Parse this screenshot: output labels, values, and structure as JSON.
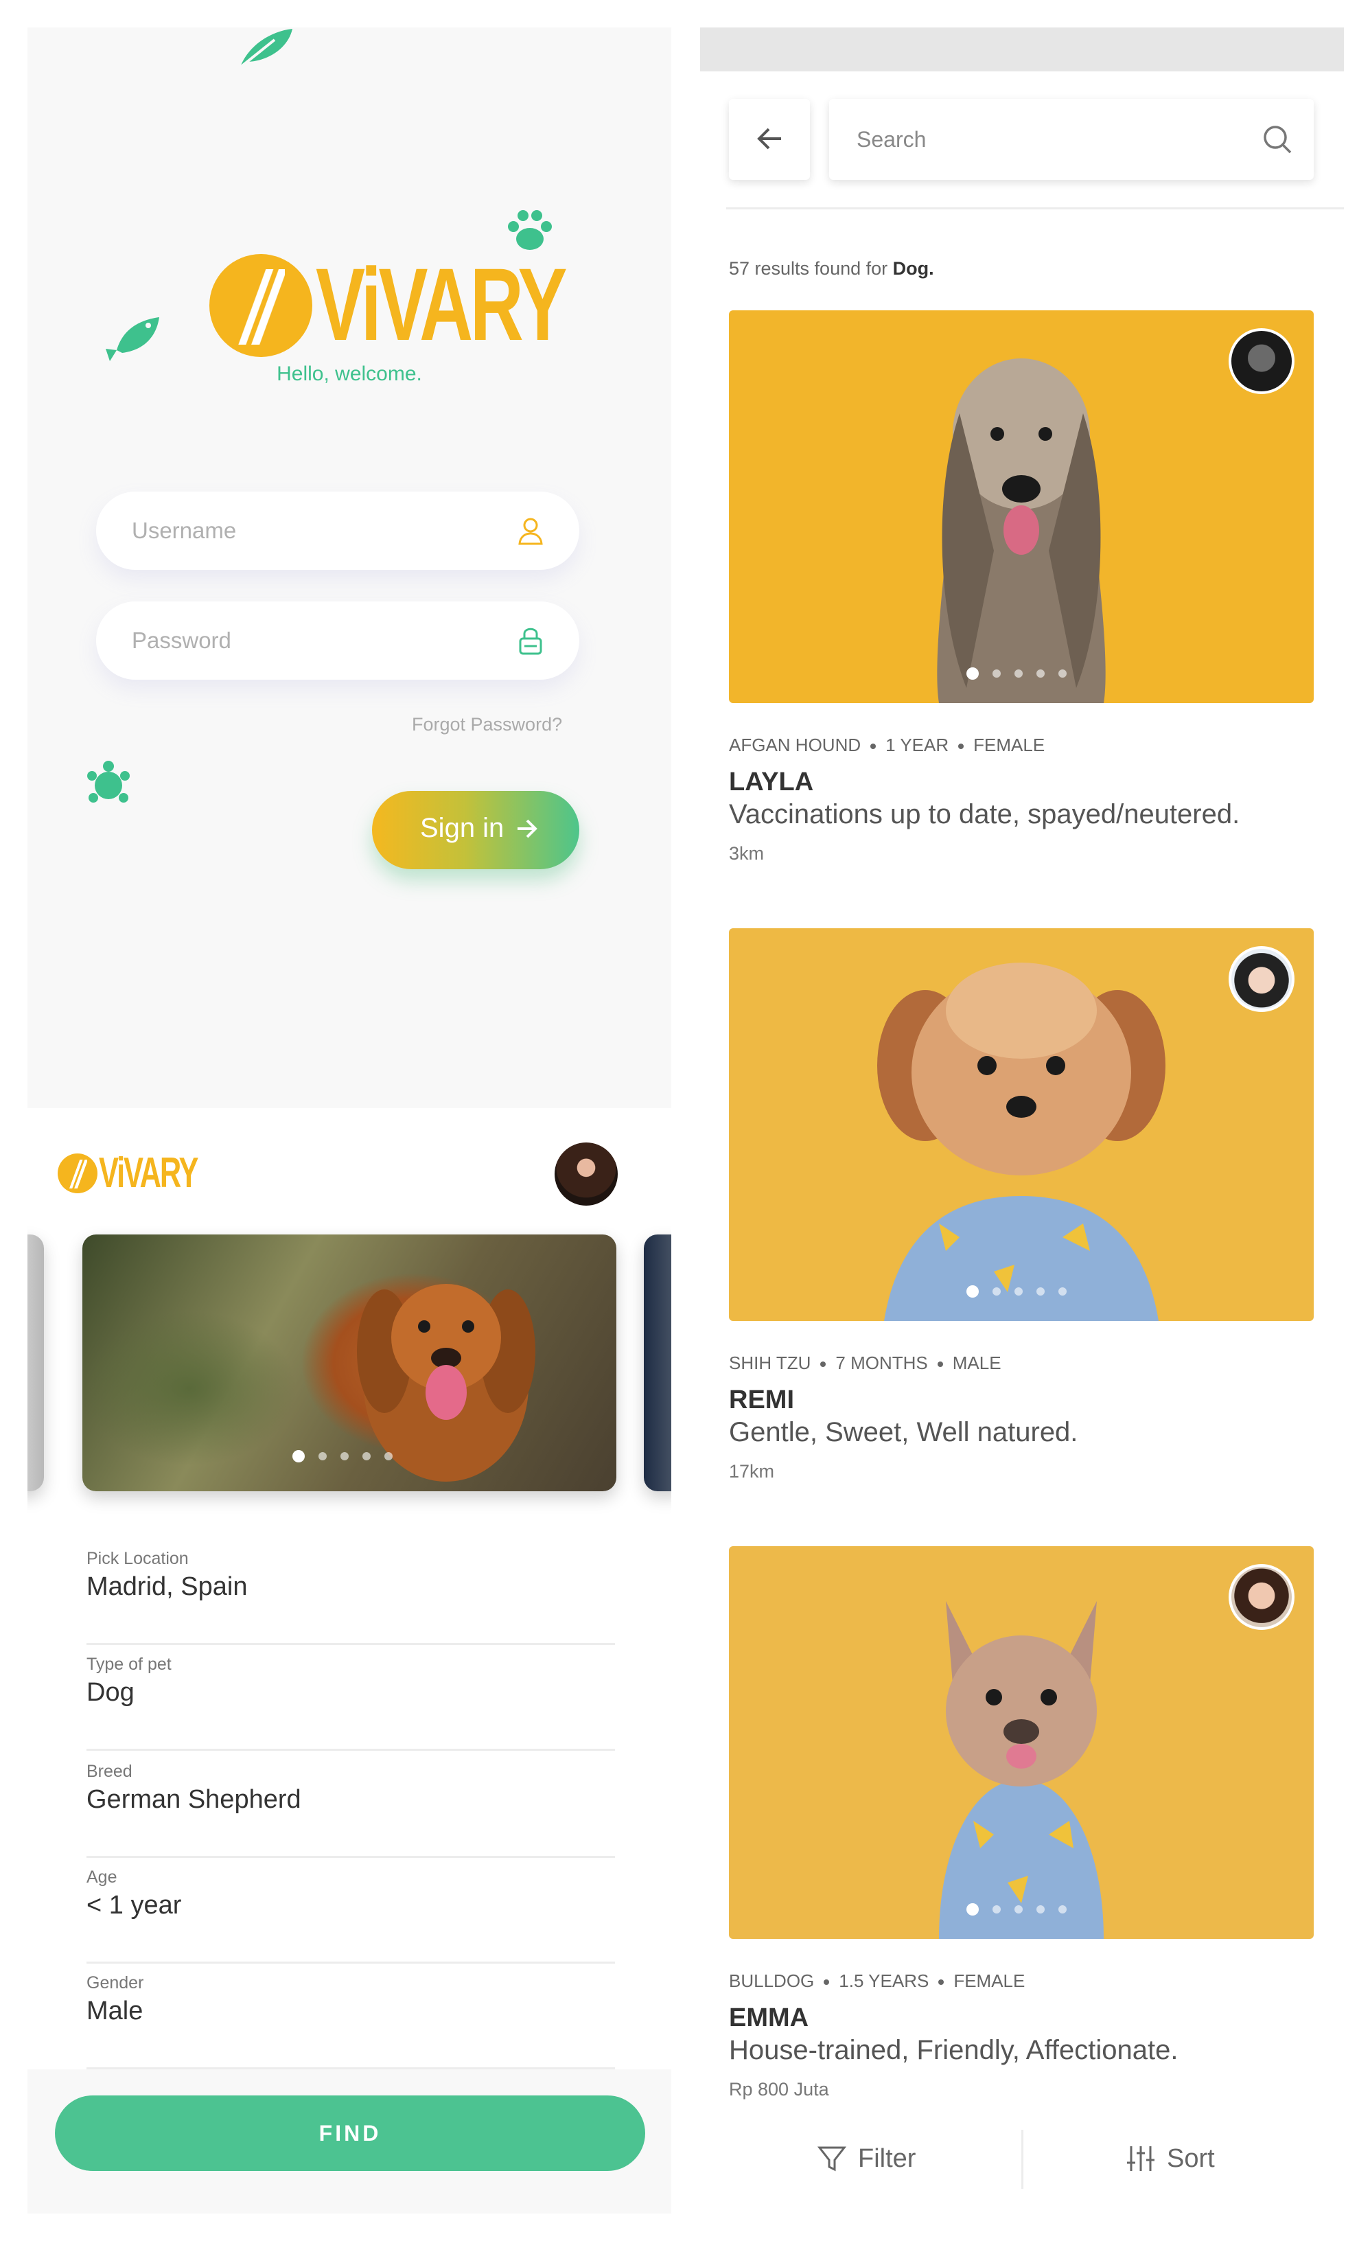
{
  "login": {
    "logo": "ViVARY",
    "welcome": "Hello, welcome.",
    "username_placeholder": "Username",
    "password_placeholder": "Password",
    "forgot": "Forgot Password?",
    "signin": "Sign in",
    "icons": [
      "leaf-icon",
      "paw-icon",
      "fish-icon",
      "turtle-icon",
      "user-icon",
      "lock-icon",
      "arrow-right-icon"
    ]
  },
  "finder": {
    "logo": "ViVARY",
    "carousel": {
      "dots": 5,
      "active": 1
    },
    "fields": [
      {
        "label": "Pick Location",
        "value": "Madrid, Spain"
      },
      {
        "label": "Type of pet",
        "value": "Dog"
      },
      {
        "label": "Breed",
        "value": "German Shepherd"
      },
      {
        "label": "Age",
        "value": "< 1 year"
      },
      {
        "label": "Gender",
        "value": "Male"
      }
    ],
    "find": "FIND"
  },
  "results": {
    "search_placeholder": "Search",
    "count_prefix": "57 results  found for",
    "count_term": "Dog.",
    "pets": [
      {
        "breed": "AFGAN HOUND",
        "age": "1 YEAR",
        "sex": "FEMALE",
        "name": "LAYLA",
        "desc": "Vaccinations up to date, spayed/neutered.",
        "extra": "3km"
      },
      {
        "breed": "SHIH TZU",
        "age": "7 MONTHS",
        "sex": "MALE",
        "name": "REMI",
        "desc": "Gentle, Sweet, Well natured.",
        "extra": "17km"
      },
      {
        "breed": "BULLDOG",
        "age": "1.5 YEARS",
        "sex": "FEMALE",
        "name": "EMMA",
        "desc": "House-trained, Friendly, Affectionate.",
        "extra": "Rp 800 Juta"
      }
    ],
    "filter": "Filter",
    "sort": "Sort"
  },
  "colors": {
    "brand_yellow": "#f5b51e",
    "brand_green": "#4cc391",
    "photo_yellow": "#f2b52b"
  }
}
